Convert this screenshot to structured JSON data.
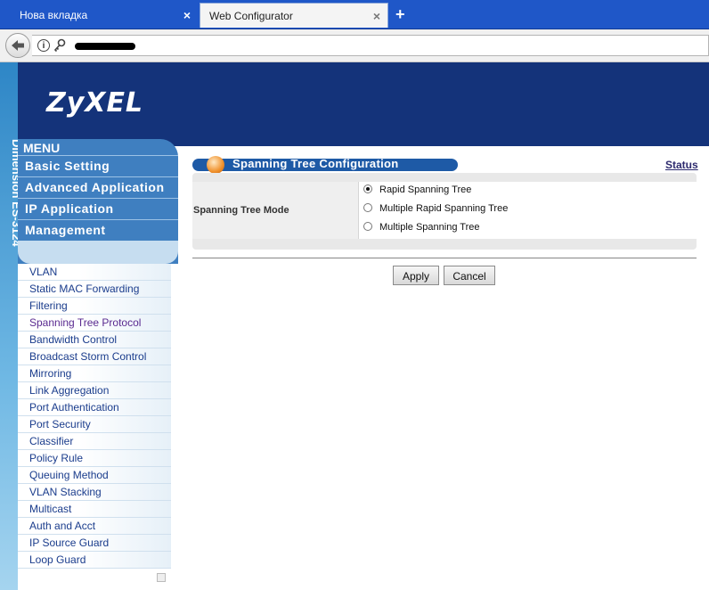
{
  "browser": {
    "tabs": [
      {
        "label": "Нова вкладка"
      },
      {
        "label": "Web Configurator"
      }
    ],
    "close_glyph": "×",
    "new_tab_glyph": "+",
    "info_glyph": "i"
  },
  "brand": {
    "logo": "ZyXEL",
    "side_vertical": "Dimension ES-3124"
  },
  "menu": {
    "title": "MENU",
    "items": [
      {
        "label": "Basic Setting"
      },
      {
        "label": "Advanced Application"
      },
      {
        "label": "IP Application"
      },
      {
        "label": "Management"
      }
    ]
  },
  "submenu": {
    "items": [
      {
        "label": "VLAN"
      },
      {
        "label": "Static MAC Forwarding"
      },
      {
        "label": "Filtering"
      },
      {
        "label": "Spanning Tree Protocol"
      },
      {
        "label": "Bandwidth Control"
      },
      {
        "label": "Broadcast Storm Control"
      },
      {
        "label": "Mirroring"
      },
      {
        "label": "Link Aggregation"
      },
      {
        "label": "Port Authentication"
      },
      {
        "label": "Port Security"
      },
      {
        "label": "Classifier"
      },
      {
        "label": "Policy Rule"
      },
      {
        "label": "Queuing Method"
      },
      {
        "label": "VLAN Stacking"
      },
      {
        "label": "Multicast"
      },
      {
        "label": "Auth and Acct"
      },
      {
        "label": "IP Source Guard"
      },
      {
        "label": "Loop Guard"
      }
    ]
  },
  "content": {
    "title": "Spanning Tree Configuration",
    "status_link": "Status",
    "mode_label": "Spanning Tree Mode",
    "options": [
      {
        "label": "Rapid Spanning Tree",
        "selected": true
      },
      {
        "label": "Multiple Rapid Spanning Tree",
        "selected": false
      },
      {
        "label": "Multiple Spanning Tree",
        "selected": false
      }
    ],
    "apply_label": "Apply",
    "cancel_label": "Cancel"
  },
  "colors": {
    "header_blue": "#14337a",
    "menu_blue": "#3f7fc0",
    "title_pill": "#1e5aa6"
  }
}
